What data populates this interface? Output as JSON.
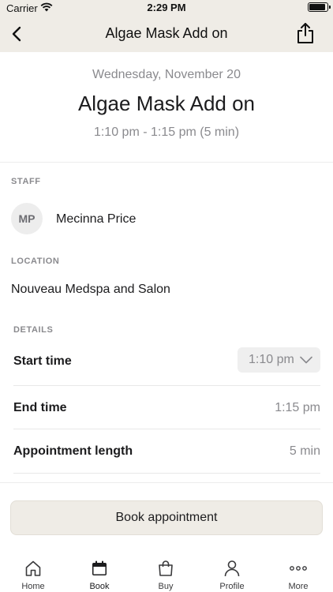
{
  "status_bar": {
    "carrier": "Carrier",
    "time": "2:29 PM"
  },
  "nav": {
    "title": "Algae Mask Add on"
  },
  "appointment": {
    "date": "Wednesday, November 20",
    "service": "Algae Mask Add on",
    "time_range": "1:10 pm - 1:15 pm (5 min)"
  },
  "staff": {
    "section_label": "STAFF",
    "initials": "MP",
    "name": "Mecinna Price"
  },
  "location": {
    "section_label": "LOCATION",
    "name": "Nouveau Medspa and Salon"
  },
  "details": {
    "section_label": "DETAILS",
    "start_time_label": "Start time",
    "start_time_value": "1:10 pm",
    "end_time_label": "End time",
    "end_time_value": "1:15 pm",
    "length_label": "Appointment length",
    "length_value": "5 min"
  },
  "book_button": "Book appointment",
  "tabs": [
    {
      "label": "Home",
      "icon": "home-icon"
    },
    {
      "label": "Book",
      "icon": "calendar-icon"
    },
    {
      "label": "Buy",
      "icon": "shopping-bag-icon"
    },
    {
      "label": "Profile",
      "icon": "person-icon"
    },
    {
      "label": "More",
      "icon": "more-dots-icon"
    }
  ],
  "colors": {
    "header_bg": "#efece6",
    "muted_text": "#8a8a8e",
    "button_bg": "#efece6"
  }
}
